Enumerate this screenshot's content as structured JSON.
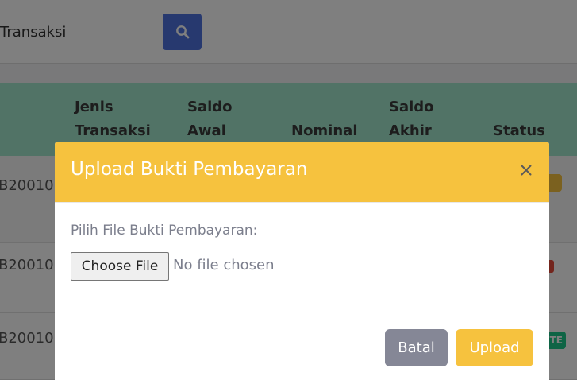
{
  "search": {
    "value": "Transaksi"
  },
  "table": {
    "headers": {
      "jenis": [
        "Jenis",
        "Transaksi"
      ],
      "saldo_awal": [
        "Saldo",
        "Awal"
      ],
      "nominal": "Nominal",
      "saldo_akhir": [
        "Saldo",
        "Akhir"
      ],
      "status": "Status"
    },
    "rows": [
      {
        "id": "B20010"
      },
      {
        "id": "B20010"
      },
      {
        "id": "B20010"
      }
    ],
    "badge_partial": "TE"
  },
  "modal": {
    "title": "Upload Bukti Pembayaran",
    "file_label": "Pilih File Bukti Pembayaran:",
    "choose_file": "Choose File",
    "no_file": "No file chosen",
    "cancel_label": "Batal",
    "upload_label": "Upload"
  },
  "colors": {
    "modal_header": "#f6c23e",
    "search_button": "#4e73df",
    "table_header": "#a3e6cc",
    "cancel_button": "#858796",
    "upload_button": "#f6c23e"
  },
  "icons": {
    "search": "search-icon",
    "close": "close-icon"
  }
}
